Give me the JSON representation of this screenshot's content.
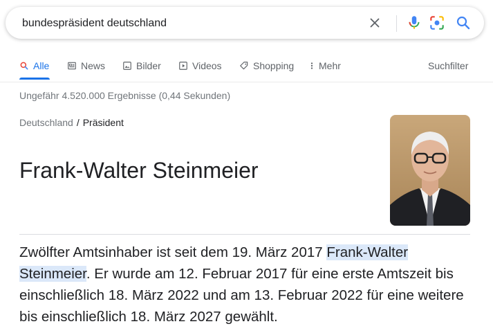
{
  "search": {
    "query": "bundespräsident deutschland"
  },
  "tabs": [
    {
      "label": "Alle",
      "icon": "search-icon",
      "active": true
    },
    {
      "label": "News",
      "icon": "news-icon"
    },
    {
      "label": "Bilder",
      "icon": "image-icon"
    },
    {
      "label": "Videos",
      "icon": "video-icon"
    },
    {
      "label": "Shopping",
      "icon": "tag-icon"
    },
    {
      "label": "Mehr",
      "icon": "more-vert-icon"
    }
  ],
  "tools_label": "Suchfilter",
  "result_stats": "Ungefähr 4.520.000 Ergebnisse (0,44 Sekunden)",
  "knowledge": {
    "breadcrumb": {
      "parent": "Deutschland",
      "separator": "/",
      "current": "Präsident"
    },
    "title": "Frank-Walter Steinmeier",
    "snippet": {
      "before": "Zwölfter Amtsinhaber ist seit dem 19. März 2017 ",
      "highlight": "Frank-Walter Steinmeier",
      "after": ". Er wurde am 12. Februar 2017 für eine erste Amtszeit bis einschließlich 18. März 2022 und am 13. Februar 2022 für eine weitere bis einschließlich 18. März 2027 gewählt."
    }
  },
  "colors": {
    "accent": "#1a73e8",
    "highlight": "#dbe8f9",
    "text": "#202124",
    "muted": "#70757a"
  }
}
